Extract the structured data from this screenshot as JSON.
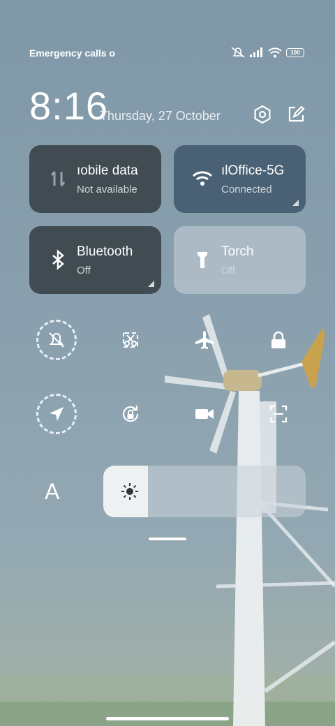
{
  "status_bar": {
    "carrier_text": "Emergency calls o",
    "battery": "100"
  },
  "header": {
    "time": "8:16",
    "date": "Thursday, 27 October",
    "icons": [
      "settings-icon",
      "edit-icon"
    ]
  },
  "tiles": [
    {
      "name": "ıobile data",
      "status": "Not available",
      "icon": "mobile-data-icon",
      "state": "off"
    },
    {
      "name": "ılOffice-5G",
      "status": "Connected",
      "icon": "wifi-icon",
      "state": "on"
    },
    {
      "name": "Bluetooth",
      "status": "Off",
      "icon": "bluetooth-icon",
      "state": "off"
    },
    {
      "name": "Torch",
      "status": "Off",
      "icon": "torch-icon",
      "state": "off-light"
    }
  ],
  "quick_toggles_row1": [
    "mute-icon",
    "screenshot-icon",
    "airplane-mode-icon",
    "lock-icon"
  ],
  "quick_toggles_row2": [
    "location-icon",
    "rotation-lock-icon",
    "screen-record-icon",
    "scanner-icon"
  ],
  "font_button": "A",
  "brightness_level": 0.22,
  "colors": {
    "tile_dark": "#3f4a51",
    "tile_active": "#4a6176",
    "tile_light": "#c9d2d8"
  }
}
